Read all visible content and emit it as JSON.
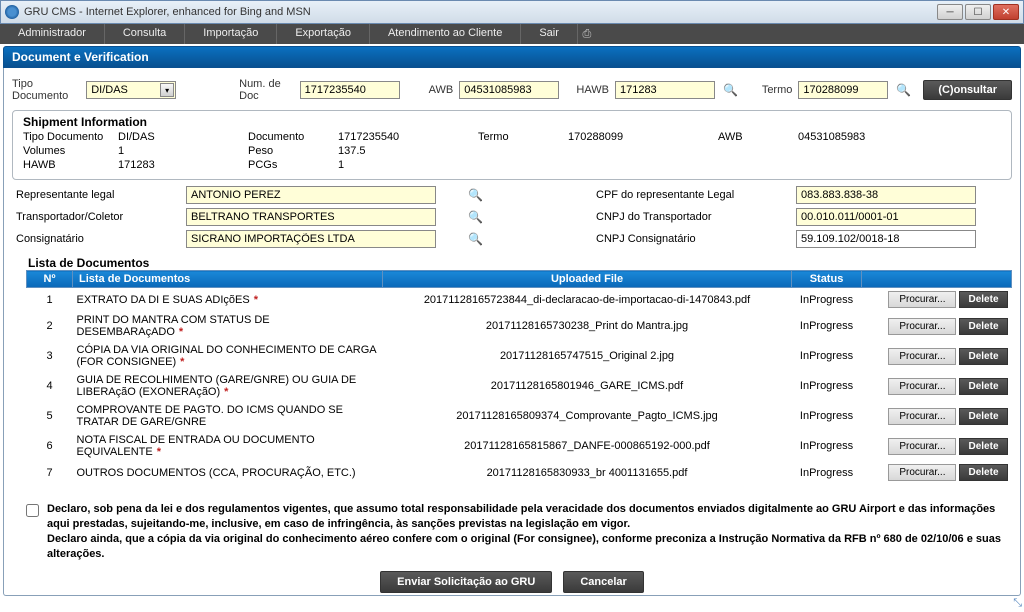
{
  "window": {
    "title": "GRU CMS - Internet Explorer, enhanced for Bing and MSN"
  },
  "menu": {
    "items": [
      "Administrador",
      "Consulta",
      "Importação",
      "Exportação",
      "Atendimento ao Cliente",
      "Sair"
    ]
  },
  "panel": {
    "title": "Document e Verification"
  },
  "search": {
    "tipoDocLabel": "Tipo Documento",
    "tipoDocValue": "DI/DAS",
    "numDocLabel": "Num. de Doc",
    "numDocValue": "1717235540",
    "awbLabel": "AWB",
    "awbValue": "04531085983",
    "hawbLabel": "HAWB",
    "hawbValue": "171283",
    "termoLabel": "Termo",
    "termoValue": "170288099",
    "consultar": "(C)onsultar"
  },
  "shipment": {
    "title": "Shipment Information",
    "rows": {
      "tipoDocLbl": "Tipo Documento",
      "tipoDocVal": "DI/DAS",
      "documentoLbl": "Documento",
      "documentoVal": "1717235540",
      "termoLbl": "Termo",
      "termoVal": "170288099",
      "awbLbl": "AWB",
      "awbVal": "04531085983",
      "volumesLbl": "Volumes",
      "volumesVal": "1",
      "pesoLbl": "Peso",
      "pesoVal": "137.5",
      "hawbLbl": "HAWB",
      "hawbVal": "171283",
      "pcgsLbl": "PCGs",
      "pcgsVal": "1"
    }
  },
  "reps": {
    "repLegalLbl": "Representante legal",
    "repLegalVal": "ANTONIO PEREZ",
    "cpfLbl": "CPF do representante Legal",
    "cpfVal": "083.883.838-38",
    "transpLbl": "Transportador/Coletor",
    "transpVal": "BELTRANO TRANSPORTES",
    "cnpjTranspLbl": "CNPJ do Transportador",
    "cnpjTranspVal": "00.010.011/0001-01",
    "consigLbl": "Consignatário",
    "consigVal": "SICRANO IMPORTAÇÕES LTDA",
    "cnpjConsigLbl": "CNPJ Consignatário",
    "cnpjConsigVal": "59.109.102/0018-18"
  },
  "docs": {
    "title": "Lista de Documentos",
    "headers": {
      "no": "Nº",
      "lista": "Lista de Documentos",
      "file": "Uploaded File",
      "status": "Status"
    },
    "procurar": "Procurar...",
    "delete": "Delete",
    "rows": [
      {
        "n": "1",
        "name": "EXTRATO DA DI E SUAS ADIçõES",
        "req": true,
        "file": "20171128165723844_di-declaracao-de-importacao-di-1470843.pdf",
        "status": "InProgress"
      },
      {
        "n": "2",
        "name": "PRINT DO MANTRA COM STATUS DE DESEMBARAçADO",
        "req": true,
        "file": "20171128165730238_Print do Mantra.jpg",
        "status": "InProgress"
      },
      {
        "n": "3",
        "name": "CÓPIA DA VIA ORIGINAL DO CONHECIMENTO DE CARGA (FOR CONSIGNEE)",
        "req": true,
        "file": "20171128165747515_Original 2.jpg",
        "status": "InProgress"
      },
      {
        "n": "4",
        "name": "GUIA DE RECOLHIMENTO (GARE/GNRE) OU GUIA DE LIBERAçãO (EXONERAçãO)",
        "req": true,
        "file": "20171128165801946_GARE_ICMS.pdf",
        "status": "InProgress"
      },
      {
        "n": "5",
        "name": "COMPROVANTE DE PAGTO. DO ICMS QUANDO SE TRATAR DE GARE/GNRE",
        "req": false,
        "file": "20171128165809374_Comprovante_Pagto_ICMS.jpg",
        "status": "InProgress"
      },
      {
        "n": "6",
        "name": "NOTA FISCAL DE ENTRADA OU DOCUMENTO EQUIVALENTE",
        "req": true,
        "file": "20171128165815867_DANFE-000865192-000.pdf",
        "status": "InProgress"
      },
      {
        "n": "7",
        "name": "OUTROS DOCUMENTOS (CCA, PROCURAÇÃO, ETC.)",
        "req": false,
        "file": "20171128165830933_br 4001131655.pdf",
        "status": "InProgress"
      }
    ]
  },
  "declare": {
    "text": "Declaro, sob pena da lei e dos regulamentos vigentes, que assumo total responsabilidade pela veracidade dos documentos enviados digitalmente ao GRU Airport e das informações aqui prestadas, sujeitando-me, inclusive, em caso de infringência, às sanções previstas na legislação em vigor.\nDeclaro ainda, que a cópia da via original do conhecimento aéreo confere com o original (For consignee), conforme preconiza a Instrução Normativa da RFB nº 680 de 02/10/06 e suas alterações."
  },
  "bottom": {
    "enviar": "Enviar Solicitação ao GRU",
    "cancelar": "Cancelar"
  }
}
